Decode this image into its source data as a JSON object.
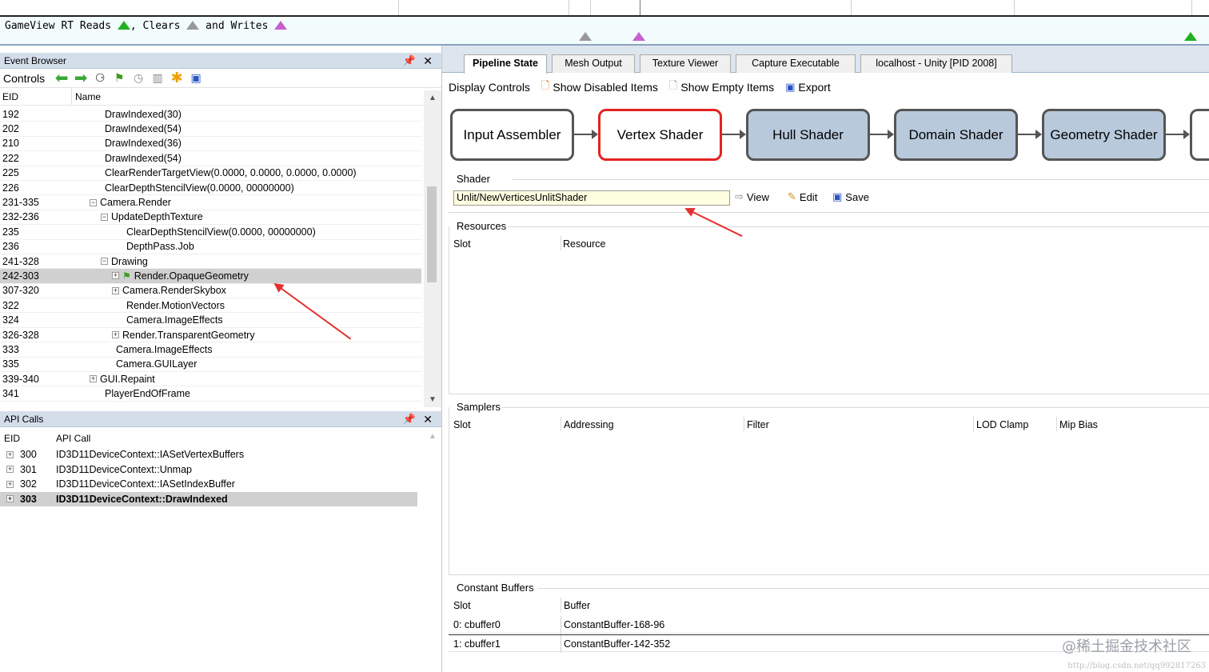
{
  "timeline": {
    "lane_parts": [
      "GameView RT Reads",
      ", Clears",
      "and Writes"
    ]
  },
  "event_browser": {
    "title": "Event Browser",
    "controls_label": "Controls",
    "columns": {
      "eid": "EID",
      "name": "Name"
    },
    "rows": [
      {
        "eid": "192",
        "name": "DrawIndexed(30)"
      },
      {
        "eid": "202",
        "name": "DrawIndexed(54)"
      },
      {
        "eid": "210",
        "name": "DrawIndexed(36)"
      },
      {
        "eid": "222",
        "name": "DrawIndexed(54)"
      },
      {
        "eid": "225",
        "name": "ClearRenderTargetView(0.0000, 0.0000, 0.0000, 0.0000)"
      },
      {
        "eid": "226",
        "name": "ClearDepthStencilView(0.0000, 00000000)"
      },
      {
        "eid": "231-335",
        "name": "Camera.Render"
      },
      {
        "eid": "232-236",
        "name": "UpdateDepthTexture"
      },
      {
        "eid": "235",
        "name": "ClearDepthStencilView(0.0000, 00000000)"
      },
      {
        "eid": "236",
        "name": "DepthPass.Job"
      },
      {
        "eid": "241-328",
        "name": "Drawing"
      },
      {
        "eid": "242-303",
        "name": "Render.OpaqueGeometry"
      },
      {
        "eid": "307-320",
        "name": "Camera.RenderSkybox"
      },
      {
        "eid": "322",
        "name": "Render.MotionVectors"
      },
      {
        "eid": "324",
        "name": "Camera.ImageEffects"
      },
      {
        "eid": "326-328",
        "name": "Render.TransparentGeometry"
      },
      {
        "eid": "333",
        "name": "Camera.ImageEffects"
      },
      {
        "eid": "335",
        "name": "Camera.GUILayer"
      },
      {
        "eid": "339-340",
        "name": "GUI.Repaint"
      },
      {
        "eid": "341",
        "name": "PlayerEndOfFrame"
      }
    ]
  },
  "api_calls": {
    "title": "API Calls",
    "columns": {
      "eid": "EID",
      "call": "API Call"
    },
    "rows": [
      {
        "eid": "300",
        "call": "ID3D11DeviceContext::IASetVertexBuffers"
      },
      {
        "eid": "301",
        "call": "ID3D11DeviceContext::Unmap"
      },
      {
        "eid": "302",
        "call": "ID3D11DeviceContext::IASetIndexBuffer"
      },
      {
        "eid": "303",
        "call": "ID3D11DeviceContext::DrawIndexed"
      }
    ]
  },
  "tabs": [
    "Pipeline State",
    "Mesh Output",
    "Texture Viewer",
    "Capture Executable",
    "localhost - Unity [PID 2008]"
  ],
  "display_controls": {
    "label": "Display Controls",
    "show_disabled": "Show Disabled Items",
    "show_empty": "Show Empty Items",
    "export": "Export"
  },
  "pipeline": [
    "Input Assembler",
    "Vertex Shader",
    "Hull Shader",
    "Domain Shader",
    "Geometry Shader"
  ],
  "shader": {
    "title": "Shader",
    "value": "Unlit/NewVerticesUnlitShader",
    "view": "View",
    "edit": "Edit",
    "save": "Save"
  },
  "resources": {
    "title": "Resources",
    "slot": "Slot",
    "resource": "Resource"
  },
  "samplers": {
    "title": "Samplers",
    "slot": "Slot",
    "addressing": "Addressing",
    "filter": "Filter",
    "lod_clamp": "LOD Clamp",
    "mip_bias": "Mip Bias"
  },
  "constant_buffers": {
    "title": "Constant Buffers",
    "slot": "Slot",
    "buffer": "Buffer",
    "rows": [
      {
        "slot": "0: cbuffer0",
        "buffer": "ConstantBuffer-168-96"
      },
      {
        "slot": "1: cbuffer1",
        "buffer": "ConstantBuffer-142-352"
      }
    ]
  },
  "watermark": "@稀土掘金技术社区",
  "watermark_url": "http://blog.csdn.net/qq992817263",
  "colors": {
    "selected_stage_border": "#e52222",
    "stage_fill": "#b8c9dc",
    "annotation_arrow": "#e53030"
  },
  "icons": [
    "back-arrow-icon",
    "forward-arrow-icon",
    "binoculars-icon",
    "flag-icon",
    "clock-icon",
    "bars-icon",
    "asterisk-icon",
    "save-icon",
    "pin-icon",
    "close-icon"
  ]
}
